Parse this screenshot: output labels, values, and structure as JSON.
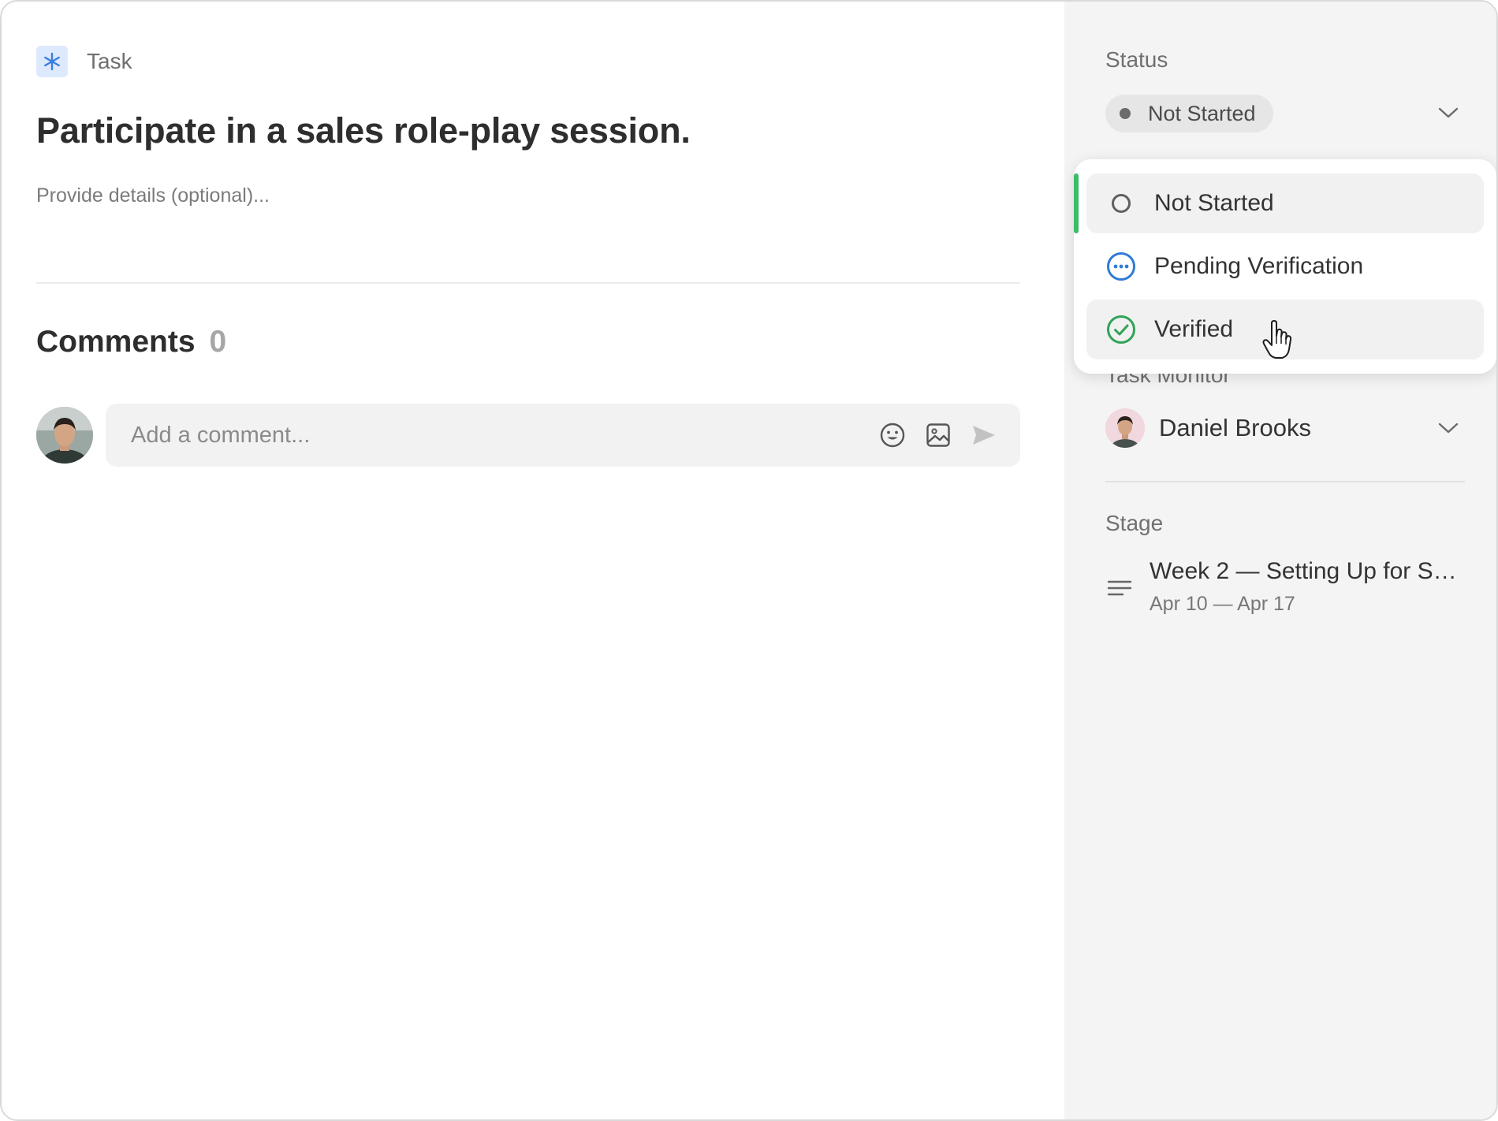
{
  "task": {
    "type_label": "Task",
    "title": "Participate in a sales role-play session.",
    "details_placeholder": "Provide details (optional)..."
  },
  "comments": {
    "title": "Comments",
    "count": "0",
    "input_placeholder": "Add a comment..."
  },
  "sidebar": {
    "status_label": "Status",
    "status_value": "Not Started",
    "monitor_label": "Task Monitor",
    "monitor_name": "Daniel Brooks",
    "stage_label": "Stage",
    "stage_title": "Week 2 — Setting Up for Sal...",
    "stage_dates": "Apr 10 — Apr 17"
  },
  "status_dropdown": {
    "options": [
      {
        "label": "Not Started",
        "icon": "circle-outline-icon"
      },
      {
        "label": "Pending Verification",
        "icon": "pending-dots-icon",
        "color": "#2f7bd6"
      },
      {
        "label": "Verified",
        "icon": "check-circle-icon",
        "color": "#2fa357"
      }
    ],
    "selected": "Not Started",
    "hovered": "Verified",
    "accent_color": "#3dbb6a"
  },
  "colors": {
    "task_icon_bg": "#dde9fc",
    "task_icon": "#3b7de0",
    "sidebar_bg": "#f4f4f4"
  }
}
